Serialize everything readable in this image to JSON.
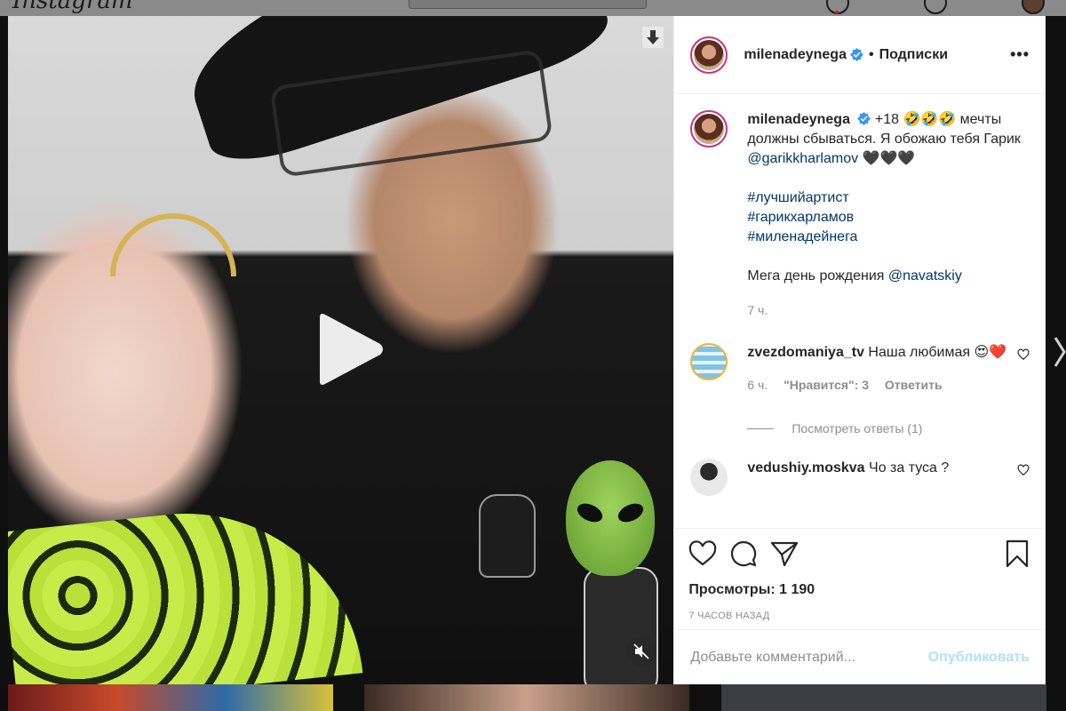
{
  "page": {
    "logo_text": "Instagram"
  },
  "modal": {
    "header": {
      "username": "milenadeynega",
      "separator": "•",
      "follow_state": "Подписки",
      "more": "•••"
    },
    "caption": {
      "username": "milenadeynega",
      "text_prefix": "+18 🤣🤣🤣 мечты должны сбываться. Я обожаю тебя Гарик ",
      "mention": "@garikkharlamov",
      "text_suffix": " 🖤🖤🖤",
      "hashtags": [
        "#лучшийартист",
        "#гарикхарламов",
        "#миленадейнега"
      ],
      "line2_prefix": "Мега день рождения ",
      "line2_mention": "@navatskiy",
      "time": "7 ч."
    },
    "comments": [
      {
        "username": "zvezdomaniya_tv",
        "text": "Наша любимая 😍❤️",
        "time": "6 ч.",
        "likes": "\"Нравится\": 3",
        "reply": "Ответить",
        "view_replies": "Посмотреть ответы (1)"
      },
      {
        "username": "vedushiy.moskva",
        "text": "Чо за туса ?"
      }
    ],
    "views": "Просмотры: 1 190",
    "posted_ago": "7 ЧАСОВ НАЗАД",
    "add_comment_placeholder": "Добавьте комментарий...",
    "publish": "Опубликовать",
    "icons": {
      "like": "heart-icon",
      "comment": "comment-icon",
      "share": "share-icon",
      "save": "bookmark-icon",
      "download": "download-icon",
      "play": "play-icon",
      "mute": "muted-speaker-icon",
      "verified": "verified-badge-icon"
    },
    "colors": {
      "link": "#00376b",
      "muted": "#8e8e8e",
      "publish_disabled": "#b2dffc",
      "verified": "#3897f0",
      "heart_red": "#ed4956"
    }
  }
}
